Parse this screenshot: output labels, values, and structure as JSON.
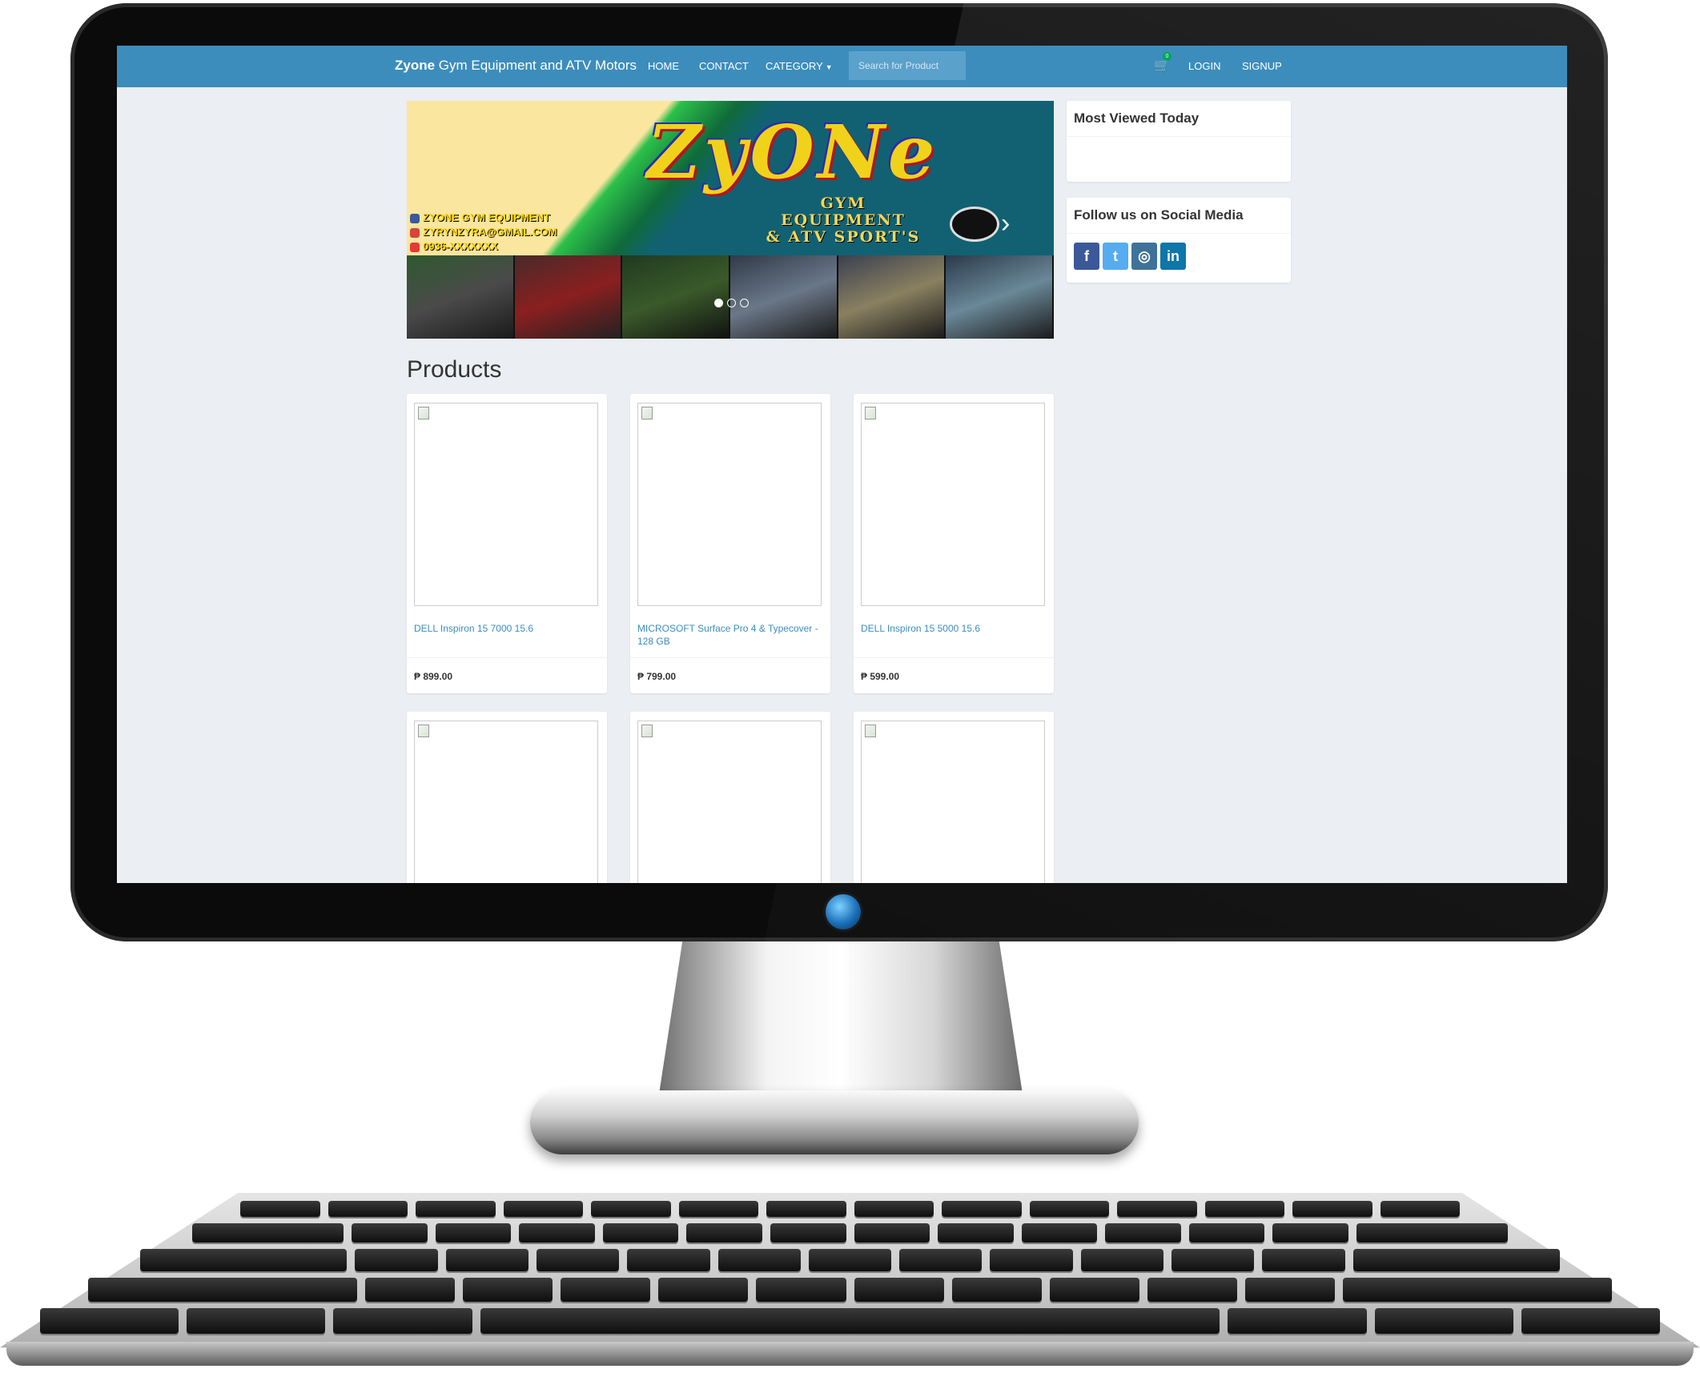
{
  "navbar": {
    "brand_bold": "Zyone",
    "brand_rest": " Gym Equipment and ATV Motors",
    "home": "HOME",
    "contact": "CONTACT",
    "category": "CATEGORY",
    "search_placeholder": "Search for Product",
    "cart_count": "0",
    "login": "LOGIN",
    "signup": "SIGNUP"
  },
  "banner": {
    "logo": "ZyONe",
    "subtitle_lines": [
      "GYM",
      "EQUIPMENT",
      "& ATV SPORT'S"
    ],
    "info_lines": [
      "ZYONE GYM EQUIPMENT",
      "ZYRYNZYRA@GMAIL.COM",
      "0936-XXXXXXX"
    ],
    "slide_count": 3,
    "active_slide": 0
  },
  "products_heading": "Products",
  "products": [
    {
      "name": "DELL Inspiron 15 7000 15.6",
      "price": "₱ 899.00"
    },
    {
      "name": "MICROSOFT Surface Pro 4 & Typecover - 128 GB",
      "price": "₱ 799.00"
    },
    {
      "name": "DELL Inspiron 15 5000 15.6",
      "price": "₱ 599.00"
    },
    {
      "name": "",
      "price": ""
    },
    {
      "name": "",
      "price": ""
    },
    {
      "name": "",
      "price": ""
    }
  ],
  "sidebar": {
    "most_viewed_title": "Most Viewed Today",
    "social_title": "Follow us on Social Media",
    "social": [
      {
        "icon": "facebook-icon",
        "glyph": "f",
        "color": "#3b5998"
      },
      {
        "icon": "twitter-icon",
        "glyph": "t",
        "color": "#55acee"
      },
      {
        "icon": "instagram-icon",
        "glyph": "◎",
        "color": "#3f729b"
      },
      {
        "icon": "linkedin-icon",
        "glyph": "in",
        "color": "#0e76a8"
      }
    ]
  },
  "colors": {
    "navbar": "#3c8dbc",
    "page_bg": "#ebeef2",
    "link": "#3c8dbc",
    "badge": "#00a65a"
  }
}
